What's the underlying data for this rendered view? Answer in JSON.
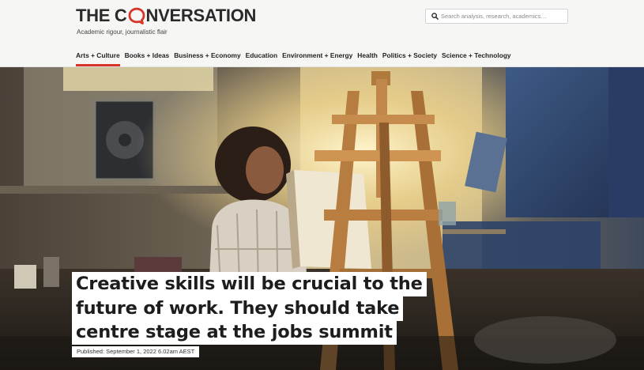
{
  "brand": {
    "logo_left": "THE C",
    "logo_right": "NVERSATION",
    "tagline": "Academic rigour, journalistic flair",
    "accent_color": "#d8352a"
  },
  "search": {
    "placeholder": "Search analysis, research, academics…",
    "icon": "search-icon"
  },
  "nav": {
    "items": [
      {
        "label": "Arts + Culture",
        "active": true
      },
      {
        "label": "Books + Ideas"
      },
      {
        "label": "Business + Economy"
      },
      {
        "label": "Education"
      },
      {
        "label": "Environment + Energy"
      },
      {
        "label": "Health"
      },
      {
        "label": "Politics + Society"
      },
      {
        "label": "Science + Technology"
      }
    ]
  },
  "article": {
    "headline_lines": [
      "Creative skills will be crucial to the",
      "future of work. They should take",
      "centre stage at the jobs summit"
    ],
    "published": "Published: September 1, 2022 6.02am AEST"
  }
}
